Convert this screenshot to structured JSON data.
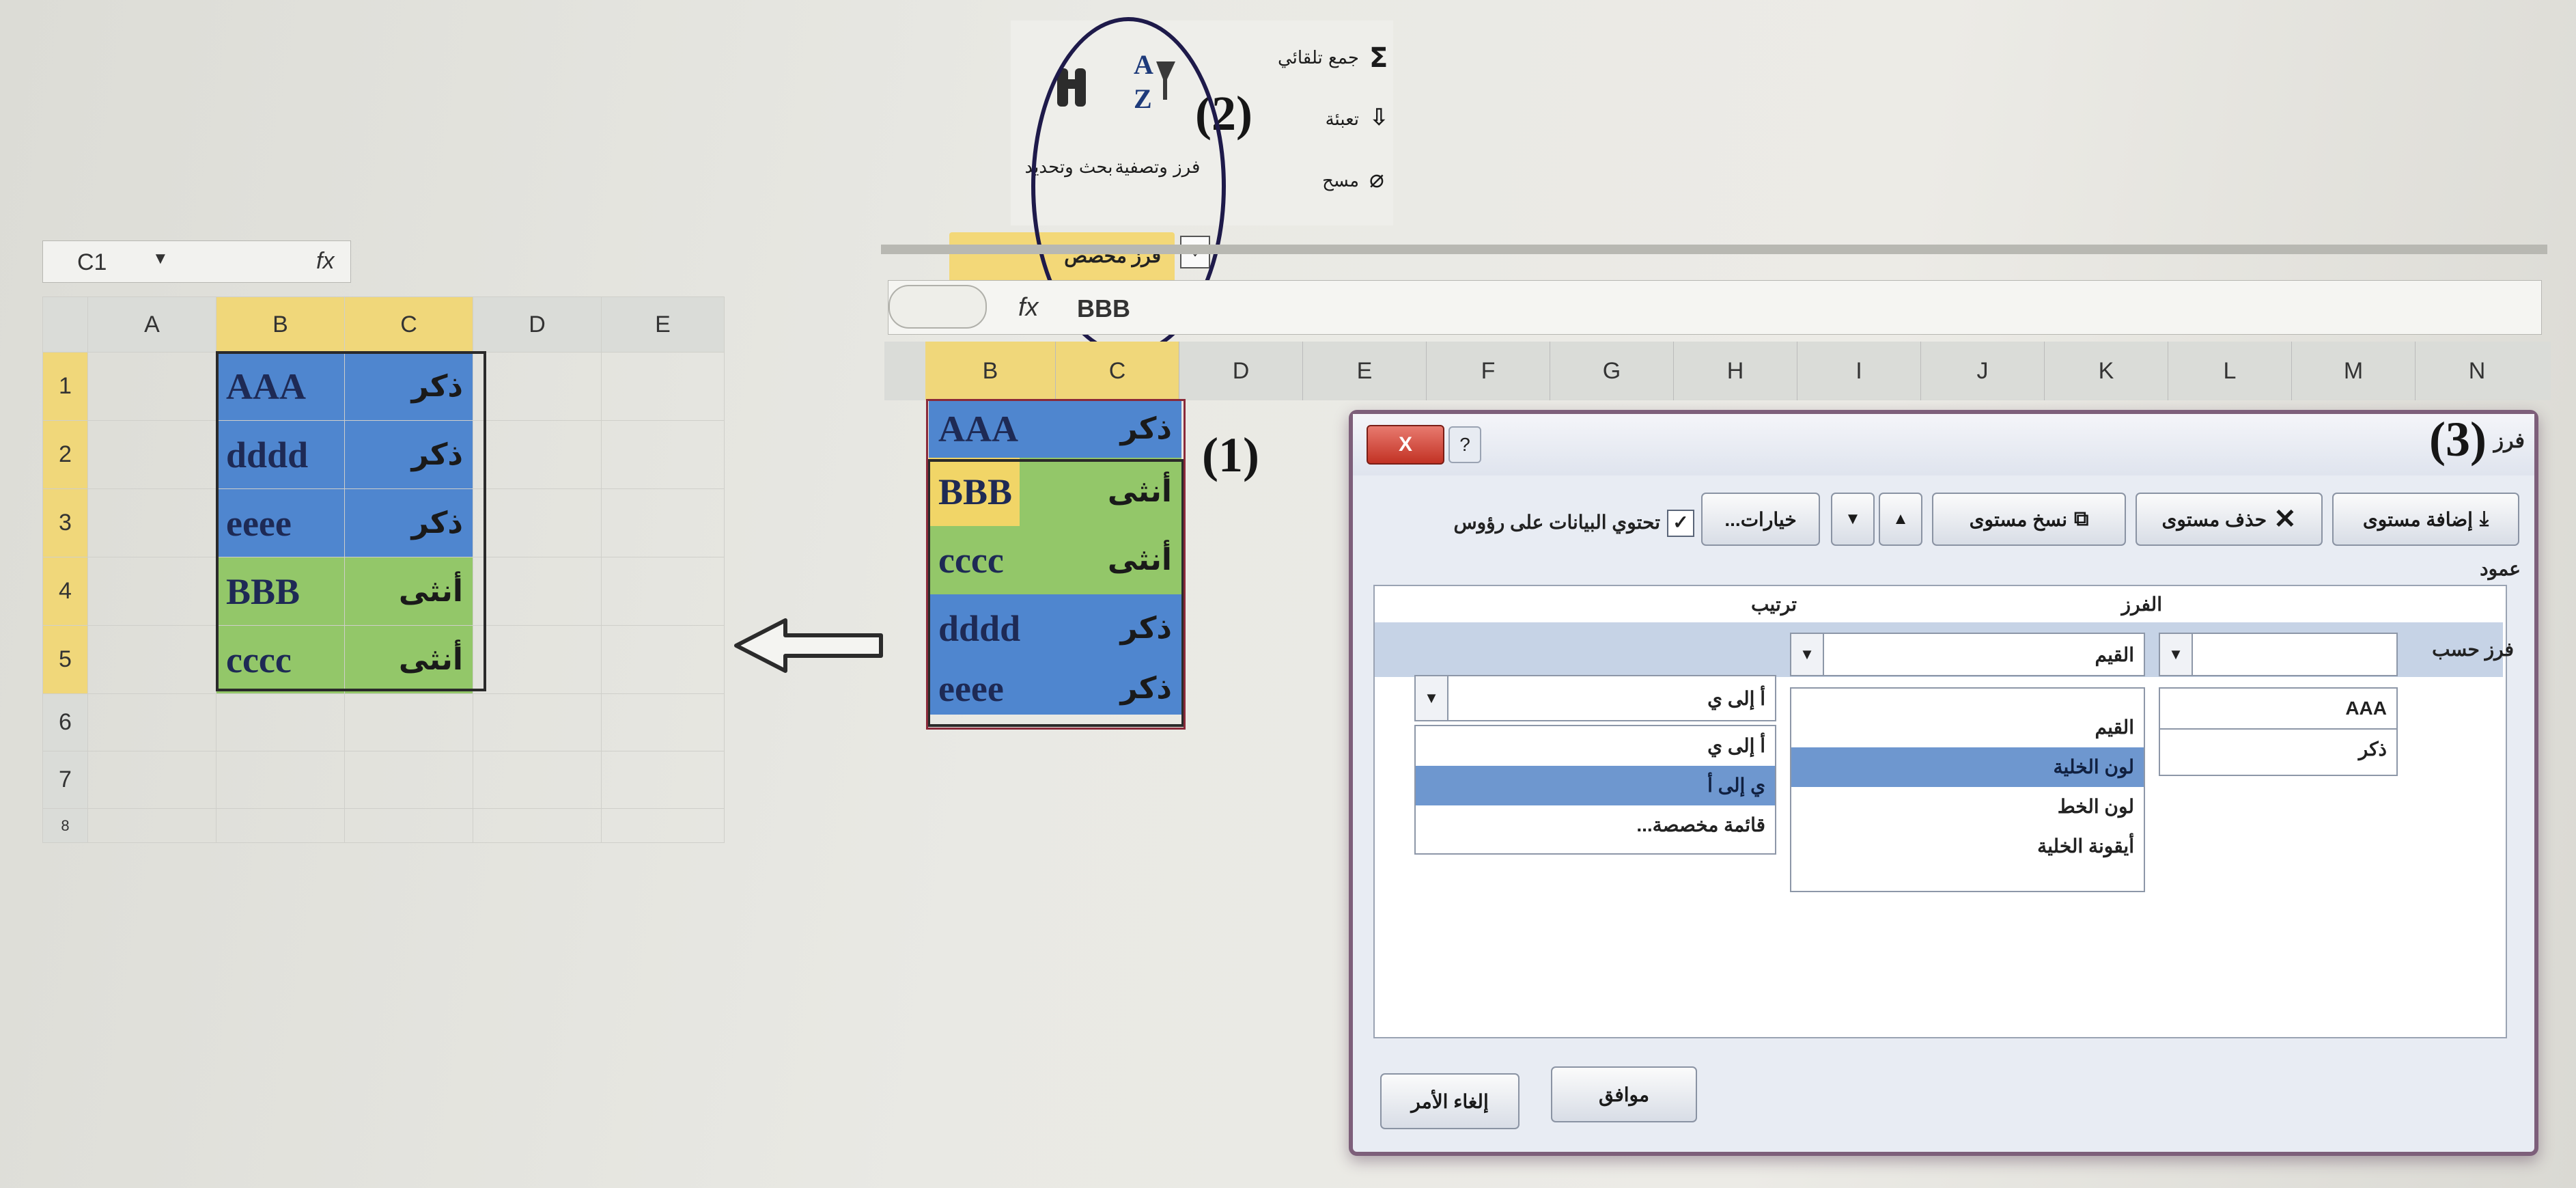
{
  "left_sheet": {
    "name_box": "C1",
    "fx": "fx",
    "columns": [
      "A",
      "B",
      "C",
      "D",
      "E"
    ],
    "rows": [
      {
        "num": "1",
        "b": "AAA",
        "c": "ذكر"
      },
      {
        "num": "2",
        "b": "dddd",
        "c": "ذكر"
      },
      {
        "num": "3",
        "b": "eeee",
        "c": "ذكر"
      },
      {
        "num": "4",
        "b": "BBB",
        "c": "أنثى"
      },
      {
        "num": "5",
        "b": "cccc",
        "c": "أنثى"
      },
      {
        "num": "6",
        "b": "",
        "c": ""
      },
      {
        "num": "7",
        "b": "",
        "c": ""
      },
      {
        "num": "8",
        "b": "",
        "c": ""
      }
    ]
  },
  "ribbon": {
    "autosum": "جمع تلقائي",
    "fill": "تعبئة",
    "clear": "مسح",
    "sort_filter": "فرز وتصفية",
    "find_select": "بحث وتحديد",
    "custom_sort": "فرز مخصص",
    "marker": "(2)"
  },
  "right_sheet": {
    "fx": "fx",
    "formula_value": "BBB",
    "columns": [
      "B",
      "C",
      "D",
      "E",
      "F",
      "G",
      "H",
      "I",
      "J",
      "K",
      "L",
      "M",
      "N"
    ],
    "rows": [
      {
        "b": "AAA",
        "c": "ذكر"
      },
      {
        "b": "BBB",
        "c": "أنثى"
      },
      {
        "b": "cccc",
        "c": "أنثى"
      },
      {
        "b": "dddd",
        "c": "ذكر"
      },
      {
        "b": "eeee",
        "c": "ذكر"
      }
    ],
    "marker": "(1)"
  },
  "dialog": {
    "title": "فرز",
    "marker": "(3)",
    "close": "X",
    "add_level": "إضافة مستوى",
    "delete_level": "حذف مستوى",
    "copy_level": "نسخ مستوى",
    "options": "خيارات...",
    "has_headers": "تحتوي البيانات على رؤوس",
    "col_header": "عمود",
    "sort_on_header": "الفرز",
    "order_header": "ترتيب",
    "sort_by": "فرز حسب",
    "column_list": [
      "AAA",
      "ذكر"
    ],
    "sort_on_value": "القيم",
    "sort_on_list": [
      "القيم",
      "لون الخلية",
      "لون الخط",
      "أيقونة الخلية"
    ],
    "order_value": "أ إلى ي",
    "order_list": [
      "أ إلى ي",
      "ي إلى أ",
      "قائمة مخصصة..."
    ],
    "ok": "موافق",
    "cancel": "إلغاء الأمر"
  }
}
